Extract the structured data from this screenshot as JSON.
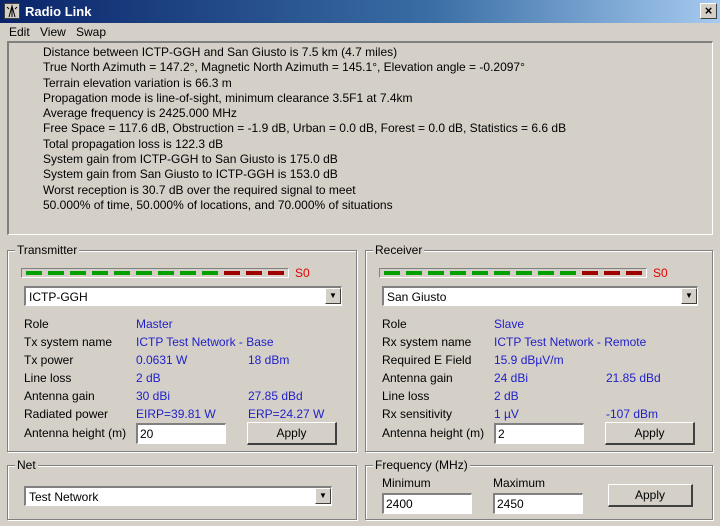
{
  "window": {
    "title": "Radio Link",
    "close_glyph": "×"
  },
  "menu": [
    "Edit",
    "View",
    "Swap"
  ],
  "report_lines": [
    "Distance between ICTP-GGH and San Giusto is 7.5 km (4.7 miles)",
    "True North Azimuth = 147.2°, Magnetic North Azimuth = 145.1°, Elevation angle = -0.2097°",
    "Terrain elevation variation is 66.3 m",
    "Propagation mode is line-of-sight, minimum clearance 3.5F1 at 7.4km",
    "Average frequency is 2425.000 MHz",
    "Free Space = 117.6 dB, Obstruction = -1.9 dB, Urban = 0.0 dB, Forest = 0.0 dB, Statistics = 6.6 dB",
    "Total propagation loss is 122.3 dB",
    "System gain from ICTP-GGH to San Giusto is 175.0 dB",
    "System gain from San Giusto to ICTP-GGH is 153.0 dB",
    "Worst reception is 30.7 dB over the required signal to meet",
    "50.000% of time, 50.000% of locations, and 70.000% of situations"
  ],
  "meter_colors": {
    "green": "#00a000",
    "red": "#a00000"
  },
  "transmitter": {
    "legend": "Transmitter",
    "meter_label": "S0",
    "station": "ICTP-GGH",
    "rows": [
      {
        "label": "Role",
        "v1": "Master",
        "v2": ""
      },
      {
        "label": "Tx system name",
        "v1": "ICTP Test Network - Base",
        "v2": ""
      },
      {
        "label": "Tx power",
        "v1": "0.0631 W",
        "v2": "18 dBm"
      },
      {
        "label": "Line loss",
        "v1": "2 dB",
        "v2": ""
      },
      {
        "label": "Antenna gain",
        "v1": "30 dBi",
        "v2": "27.85 dBd"
      },
      {
        "label": "Radiated power",
        "v1": "EIRP=39.81 W",
        "v2": "ERP=24.27 W"
      }
    ],
    "height_label": "Antenna height (m)",
    "height_value": "20",
    "apply": "Apply"
  },
  "receiver": {
    "legend": "Receiver",
    "meter_label": "S0",
    "station": "San Giusto",
    "rows": [
      {
        "label": "Role",
        "v1": "Slave",
        "v2": ""
      },
      {
        "label": "Rx system name",
        "v1": "ICTP Test Network - Remote",
        "v2": ""
      },
      {
        "label": "Required E Field",
        "v1": "15.9 dBµV/m",
        "v2": ""
      },
      {
        "label": "Antenna gain",
        "v1": "24 dBi",
        "v2": "21.85 dBd"
      },
      {
        "label": "Line loss",
        "v1": "2 dB",
        "v2": ""
      },
      {
        "label": "Rx sensitivity",
        "v1": "1 µV",
        "v2": "-107 dBm"
      }
    ],
    "height_label": "Antenna height (m)",
    "height_value": "2",
    "apply": "Apply"
  },
  "net": {
    "legend": "Net",
    "value": "Test Network"
  },
  "frequency": {
    "legend": "Frequency (MHz)",
    "min_label": "Minimum",
    "min_value": "2400",
    "max_label": "Maximum",
    "max_value": "2450",
    "apply": "Apply"
  }
}
